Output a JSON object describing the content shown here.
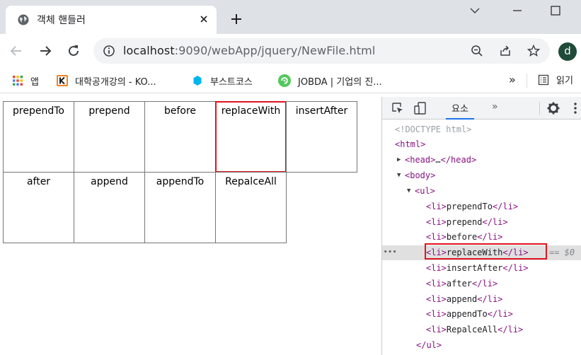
{
  "browser": {
    "tab": {
      "title": "객체 핸들러"
    },
    "address": {
      "host": "localhost",
      "path": ":9090/webApp/jquery/NewFile.html"
    },
    "profile_initial": "d",
    "bookmarks": [
      {
        "label": "앱",
        "icon": "apps-grid-icon"
      },
      {
        "label": "대학공개강의 - KO...",
        "icon": "kocw-icon"
      },
      {
        "label": "부스트코스",
        "icon": "boostcourse-icon"
      },
      {
        "label": "JOBDA | 기업의 진...",
        "icon": "jobda-icon"
      }
    ],
    "bookmarks_overflow": "»",
    "reading_list": "읽기"
  },
  "page": {
    "items": [
      "prependTo",
      "prepend",
      "before",
      "replaceWith",
      "insertAfter",
      "after",
      "append",
      "appendTo",
      "RepalceAll"
    ],
    "highlighted_index": 3,
    "highlight_color": "#e0141e"
  },
  "devtools": {
    "tab_label": "요소",
    "more_tabs": "»",
    "doctype": "<!DOCTYPE html>",
    "html_open": "<html>",
    "head_line": {
      "open": "<head>",
      "ellipsis": "…",
      "close": "</head>"
    },
    "body_open": "<body>",
    "ul_open": "<ul>",
    "ul_close": "</ul>",
    "li_open": "<li>",
    "li_close": "</li>",
    "selected_suffix": "== $0",
    "gutter_dots": "•••"
  }
}
